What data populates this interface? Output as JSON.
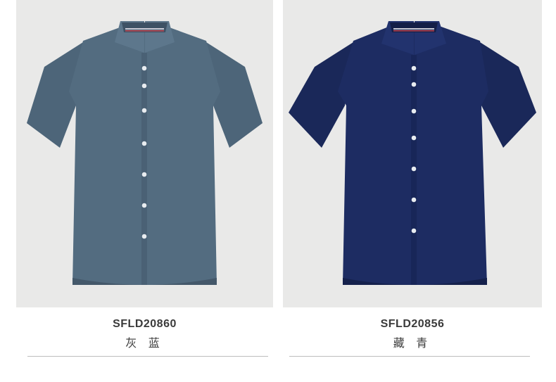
{
  "products": [
    {
      "code": "SFLD20860",
      "color_name": "灰 蓝",
      "shirt_color": "#536c80",
      "shirt_shade": "#44586a",
      "image_alt": "short-sleeve-shirt-gray-blue"
    },
    {
      "code": "SFLD20856",
      "color_name": "藏 青",
      "shirt_color": "#1d2c62",
      "shirt_shade": "#15214c",
      "image_alt": "short-sleeve-shirt-navy"
    }
  ],
  "colors": {
    "card_background": "#e9e9e8",
    "text": "#3a3a3a",
    "divider": "#bdbdbd"
  }
}
